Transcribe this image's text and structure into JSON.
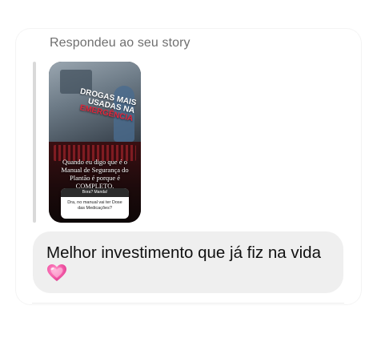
{
  "reply": {
    "header": "Respondeu ao seu story"
  },
  "story": {
    "title_line1": "DROGAS MAIS",
    "title_line2": "USADAS NA",
    "title_line3": "EMERGÊNCIA",
    "caption": "Quando eu digo que é o Manual de Segurança do Plantão é porque é COMPLETO.",
    "question_header": "Bora? Manda!",
    "question_text": "Dra, no manual vai ter Dose das Medicações?",
    "accent_color": "#e2253a"
  },
  "message": {
    "text": "Melhor investimento que já fiz na vida",
    "emoji_icon": "pink-sparkling-heart-icon",
    "bubble_color": "#efefef"
  }
}
